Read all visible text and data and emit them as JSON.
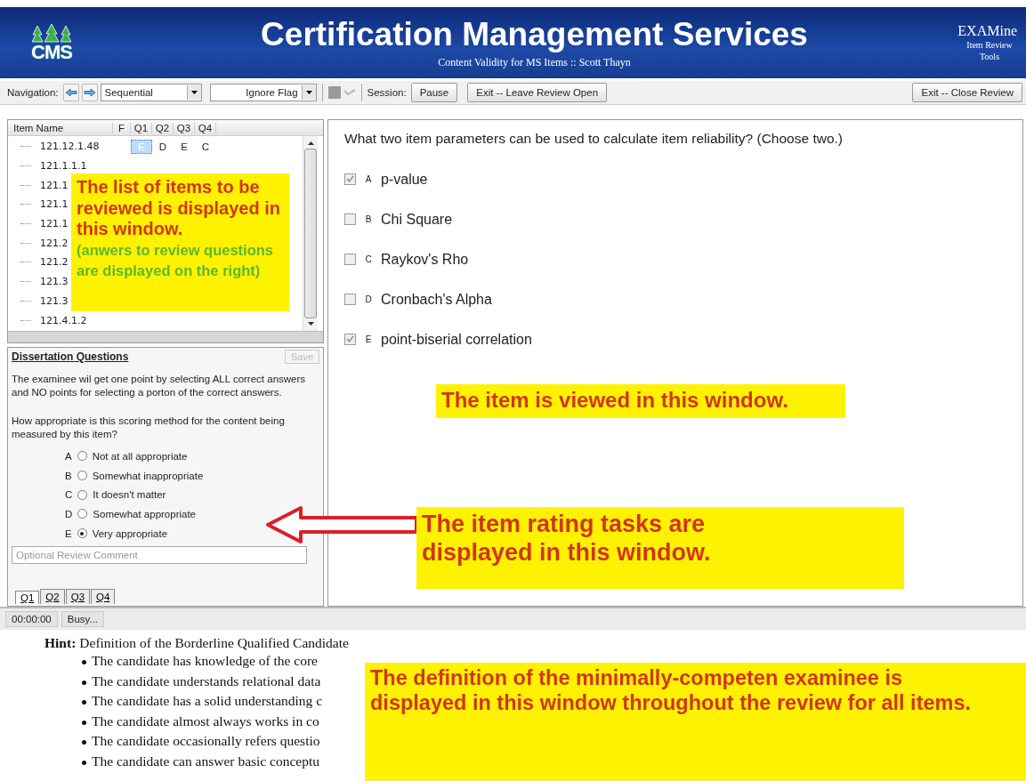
{
  "header": {
    "logo": "CMS",
    "title": "Certification Management Services",
    "subtitle": "Content Validity for MS Items :: Scott Thayn",
    "app_name": "EXAMine",
    "app_subtitle": "Item Review Tools"
  },
  "toolbar": {
    "navigation_label": "Navigation:",
    "order_select": "Sequential",
    "flag_select": "Ignore Flag",
    "session_label": "Session:",
    "buttons": [
      "Pause",
      "Exit -- Leave Review Open"
    ],
    "close_button": "Exit -- Close Review"
  },
  "item_list": {
    "columns": [
      "Item Name",
      "F",
      "Q1",
      "Q2",
      "Q3",
      "Q4"
    ],
    "rows": [
      {
        "name": "121.12.1.48",
        "answers": [
          {
            "text": "E",
            "selected": true
          },
          {
            "text": "D",
            "selected": false
          },
          {
            "text": "E",
            "selected": false
          },
          {
            "text": "C",
            "selected": false
          }
        ]
      },
      {
        "name": "121.1.1.1"
      },
      {
        "name": "121.1"
      },
      {
        "name": "121.1"
      },
      {
        "name": "121.1"
      },
      {
        "name": "121.2"
      },
      {
        "name": "121.2"
      },
      {
        "name": "121.3"
      },
      {
        "name": "121.3"
      },
      {
        "name": "121.4.1.2"
      }
    ]
  },
  "rating_panel": {
    "title": "Dissertation Questions",
    "save_button": {
      "label": "Save",
      "disabled": true
    },
    "statement": "The examinee wil get one point by selecting ALL correct answers and NO points for selecting a porton of the correct answers.",
    "question": "How appropriate is this scoring method for the content being measured by this item?",
    "options": [
      {
        "letter": "A",
        "label": "Not at all appropriate",
        "selected": false
      },
      {
        "letter": "B",
        "label": "Somewhat inappropriate",
        "selected": false
      },
      {
        "letter": "C",
        "label": "It doesn't matter",
        "selected": false
      },
      {
        "letter": "D",
        "label": "Somewhat appropriate",
        "selected": false
      },
      {
        "letter": "E",
        "label": "Very appropriate",
        "selected": true
      }
    ],
    "comment_placeholder": "Optional Review Comment",
    "tabs": [
      {
        "label": "Q1",
        "selected": true
      },
      {
        "label": "Q2",
        "selected": false
      },
      {
        "label": "Q3",
        "selected": false
      },
      {
        "label": "Q4",
        "selected": false
      }
    ]
  },
  "item": {
    "question": "What two item parameters can be used to calculate item reliability? (Choose two.)",
    "choices": [
      {
        "letter": "A",
        "label": "p-value",
        "checked": true
      },
      {
        "letter": "B",
        "label": "Chi Square",
        "checked": false
      },
      {
        "letter": "C",
        "label": "Raykov's Rho",
        "checked": false
      },
      {
        "letter": "D",
        "label": "Cronbach's Alpha",
        "checked": false
      },
      {
        "letter": "E",
        "label": "point-biserial correlation",
        "checked": true
      }
    ]
  },
  "status_bar": {
    "timer": "00:00:00",
    "status": "Busy..."
  },
  "hint": {
    "label": "Hint:",
    "title": "Definition of the Borderline Qualified Candidate",
    "bullets": [
      "The candidate has knowledge of the core",
      "The candidate understands relational data",
      "The candidate has a solid understanding c",
      "The candidate almost always works in co",
      "The candidate occasionally refers questio",
      "The candidate can answer basic conceptu"
    ]
  },
  "callouts": [
    {
      "kind": "list",
      "text": "The list of items to be reviewed is displayed in this window.",
      "note": "(anwers to review questions are displayed on the right)"
    },
    {
      "kind": "item",
      "text": "The item is viewed in this window."
    },
    {
      "kind": "rating",
      "text": "The item rating tasks are displayed in this window."
    },
    {
      "kind": "definition",
      "text": "The definition of the minimally-competen examinee is displayed in this window throughout the review for all items."
    }
  ]
}
